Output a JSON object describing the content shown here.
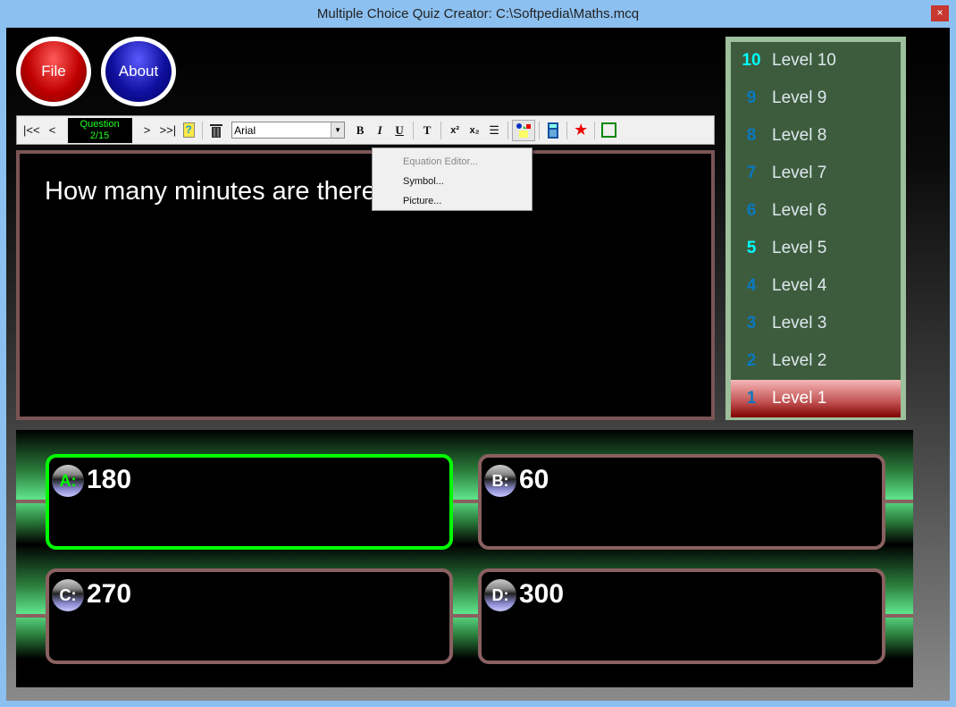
{
  "window": {
    "title": "Multiple Choice Quiz Creator: C:\\Softpedia\\Maths.mcq",
    "close": "×"
  },
  "buttons": {
    "file": "File",
    "about": "About"
  },
  "toolbar": {
    "first": "|<<",
    "prev": "<",
    "question_label": "Question",
    "question_counter": "2/15",
    "next": ">",
    "last": ">>|",
    "font": "Arial",
    "bold": "B",
    "italic": "I",
    "underline": "U",
    "text": "T",
    "superscript": "x²",
    "subscript": "x₂"
  },
  "insert_menu": {
    "items": [
      {
        "label": "Equation Editor...",
        "disabled": true
      },
      {
        "label": "Symbol...",
        "disabled": false
      },
      {
        "label": "Picture...",
        "disabled": false
      }
    ]
  },
  "question": {
    "text": "How many minutes are there in 3 hours?"
  },
  "levels": [
    {
      "num": "10",
      "label": "Level 10",
      "highlight": true
    },
    {
      "num": "9",
      "label": "Level 9"
    },
    {
      "num": "8",
      "label": "Level 8"
    },
    {
      "num": "7",
      "label": "Level 7"
    },
    {
      "num": "6",
      "label": "Level 6"
    },
    {
      "num": "5",
      "label": "Level 5",
      "highlight": true
    },
    {
      "num": "4",
      "label": "Level 4"
    },
    {
      "num": "3",
      "label": "Level 3"
    },
    {
      "num": "2",
      "label": "Level 2"
    },
    {
      "num": "1",
      "label": "Level 1",
      "selected": true
    }
  ],
  "answers": [
    {
      "key": "A:",
      "value": "180",
      "correct": true
    },
    {
      "key": "B:",
      "value": "60"
    },
    {
      "key": "C:",
      "value": "270"
    },
    {
      "key": "D:",
      "value": "300"
    }
  ],
  "colors": {
    "correct": "#00ff00",
    "level_panel": "#3d5c3d",
    "selected_level": "#c05050"
  }
}
